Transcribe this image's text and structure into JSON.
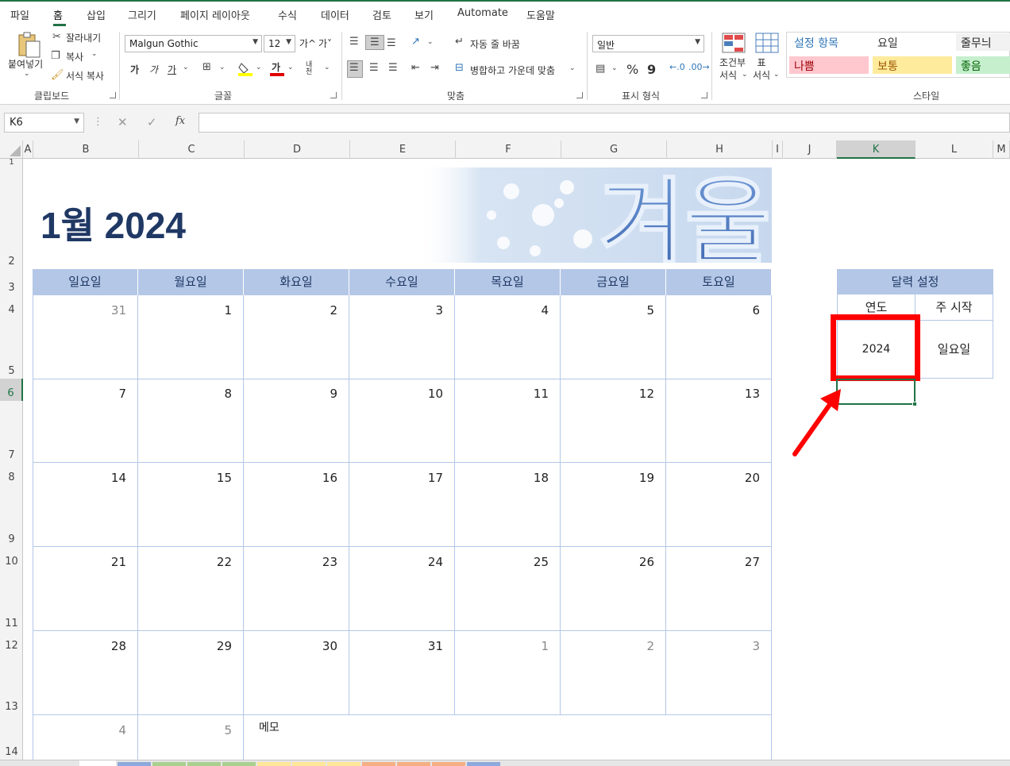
{
  "menu": [
    "파일",
    "홈",
    "삽입",
    "그리기",
    "페이지 레이아웃",
    "수식",
    "데이터",
    "검토",
    "보기",
    "Automate",
    "도움말"
  ],
  "ribbon": {
    "clipboard": {
      "paste": "붙여넣기",
      "cut": "잘라내기",
      "copy": "복사",
      "format_painter": "서식 복사",
      "label": "클립보드"
    },
    "font": {
      "name": "Malgun Gothic",
      "size": "12",
      "label": "글꼴",
      "bold": "가",
      "italic": "가",
      "underline": "가",
      "grow": "가^",
      "shrink": "가˅",
      "phonetic": "내천",
      "color_letter": "가"
    },
    "align": {
      "wrap": "자동 줄 바꿈",
      "merge": "병합하고 가운데 맞춤",
      "label": "맞춤"
    },
    "number": {
      "format": "일반",
      "percent": "%",
      "comma": "9",
      "label": "표시 형식"
    },
    "styles": {
      "conditional": "조건부\n서식",
      "table": "표\n서식",
      "label": "스타일",
      "cells": [
        {
          "text": "설정 항목",
          "bg": "#ffffff",
          "fg": "#2e75b6"
        },
        {
          "text": "요일",
          "bg": "#ffffff",
          "fg": "#333333"
        },
        {
          "text": "줄무늬",
          "bg": "#f2f2f2",
          "fg": "#222222"
        },
        {
          "text": "나쁨",
          "bg": "#ffc7ce",
          "fg": "#9c0006"
        },
        {
          "text": "보통",
          "bg": "#ffeb9c",
          "fg": "#9c5700"
        },
        {
          "text": "좋음",
          "bg": "#c6efce",
          "fg": "#006100"
        }
      ]
    }
  },
  "formula_bar": {
    "name_box": "K6",
    "fx": "fx",
    "value": ""
  },
  "columns": [
    "A",
    "B",
    "C",
    "D",
    "E",
    "F",
    "G",
    "H",
    "I",
    "J",
    "K",
    "L",
    "M"
  ],
  "rows": [
    "1",
    "2",
    "3",
    "4",
    "5",
    "6",
    "7",
    "8",
    "9",
    "10",
    "11",
    "12",
    "13",
    "14"
  ],
  "calendar": {
    "title": "1월 2024",
    "banner_text": "겨울",
    "days": [
      "일요일",
      "월요일",
      "화요일",
      "수요일",
      "목요일",
      "금요일",
      "토요일"
    ],
    "weeks": [
      [
        {
          "d": "31",
          "dim": true
        },
        {
          "d": "1"
        },
        {
          "d": "2"
        },
        {
          "d": "3"
        },
        {
          "d": "4"
        },
        {
          "d": "5"
        },
        {
          "d": "6"
        }
      ],
      [
        {
          "d": "7"
        },
        {
          "d": "8"
        },
        {
          "d": "9"
        },
        {
          "d": "10"
        },
        {
          "d": "11"
        },
        {
          "d": "12"
        },
        {
          "d": "13"
        }
      ],
      [
        {
          "d": "14"
        },
        {
          "d": "15"
        },
        {
          "d": "16"
        },
        {
          "d": "17"
        },
        {
          "d": "18"
        },
        {
          "d": "19"
        },
        {
          "d": "20"
        }
      ],
      [
        {
          "d": "21"
        },
        {
          "d": "22"
        },
        {
          "d": "23"
        },
        {
          "d": "24"
        },
        {
          "d": "25"
        },
        {
          "d": "26"
        },
        {
          "d": "27"
        }
      ],
      [
        {
          "d": "28"
        },
        {
          "d": "29"
        },
        {
          "d": "30"
        },
        {
          "d": "31"
        },
        {
          "d": "1",
          "dim": true
        },
        {
          "d": "2",
          "dim": true
        },
        {
          "d": "3",
          "dim": true
        }
      ]
    ],
    "extra": [
      {
        "d": "4",
        "dim": true
      },
      {
        "d": "5",
        "dim": true
      }
    ],
    "memo": "메모"
  },
  "settings": {
    "header": "달력 설정",
    "year_label": "연도",
    "week_start_label": "주 시작",
    "year": "2024",
    "week_start": "일요일"
  },
  "colors": {
    "accent": "#217346",
    "header_fill": "#b4c7e7",
    "title": "#1f3864",
    "highlight": "#ff0000"
  },
  "sheet_tab_colors": [
    "#8ea9db",
    "#a9d08e",
    "#a9d08e",
    "#a9d08e",
    "#ffe699",
    "#ffe699",
    "#ffe699",
    "#f4b084",
    "#f4b084",
    "#f4b084",
    "#8ea9db"
  ]
}
